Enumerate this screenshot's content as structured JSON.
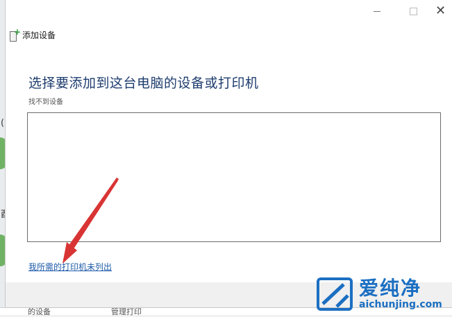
{
  "window": {
    "header_title": "添加设备",
    "minimize_icon": "minimize-icon",
    "maximize_icon": "maximize-icon",
    "close_icon": "close-icon"
  },
  "main": {
    "title": "选择要添加到这台电脑的设备或打印机",
    "status": "找不到设备",
    "printer_not_listed_link": "我所需的打印机未列出"
  },
  "background": {
    "left_char": "(",
    "left_char2": "酉",
    "bottom_text_1": "的设备",
    "bottom_text_2": "管理打印"
  },
  "watermark": {
    "brand_cn": "爱纯净",
    "brand_en": "aichunjing.com"
  },
  "colors": {
    "title": "#1e3c6e",
    "link": "#1d5aa8",
    "arrow": "#d93434",
    "watermark": "#1b6fc2"
  }
}
